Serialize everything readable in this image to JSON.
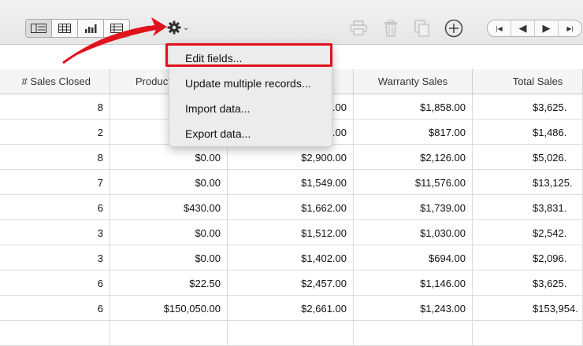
{
  "toolbar": {
    "view_buttons": [
      "layout-view-icon",
      "table-view-icon",
      "chart-view-icon",
      "list-view-icon"
    ],
    "gear_icon": "gear-icon",
    "tools": [
      "print-icon",
      "trash-icon",
      "duplicate-icon",
      "add-icon"
    ],
    "nav_buttons": [
      "|◀",
      "◀",
      "▶",
      "▶|"
    ]
  },
  "menu": {
    "items": [
      "Edit fields...",
      "Update multiple records...",
      "Import data...",
      "Export data..."
    ]
  },
  "table": {
    "columns": [
      "# Sales Closed",
      "Product Sales",
      "",
      "Warranty Sales",
      "Total Sales"
    ],
    "rows": [
      [
        "8",
        "",
        ".00",
        "$1,858.00",
        "$3,625."
      ],
      [
        "2",
        "",
        ".00",
        "$817.00",
        "$1,486."
      ],
      [
        "8",
        "$0.00",
        "$2,900.00",
        "$2,126.00",
        "$5,026."
      ],
      [
        "7",
        "$0.00",
        "$1,549.00",
        "$11,576.00",
        "$13,125."
      ],
      [
        "6",
        "$430.00",
        "$1,662.00",
        "$1,739.00",
        "$3,831."
      ],
      [
        "3",
        "$0.00",
        "$1,512.00",
        "$1,030.00",
        "$2,542."
      ],
      [
        "3",
        "$0.00",
        "$1,402.00",
        "$694.00",
        "$2,096."
      ],
      [
        "6",
        "$22.50",
        "$2,457.00",
        "$1,146.00",
        "$3,625."
      ],
      [
        "6",
        "$150,050.00",
        "$2,661.00",
        "$1,243.00",
        "$153,954."
      ],
      [
        "",
        "",
        "",
        "",
        ""
      ]
    ]
  },
  "colors": {
    "highlight": "#e0121c",
    "menu_bg": "#ececec"
  }
}
